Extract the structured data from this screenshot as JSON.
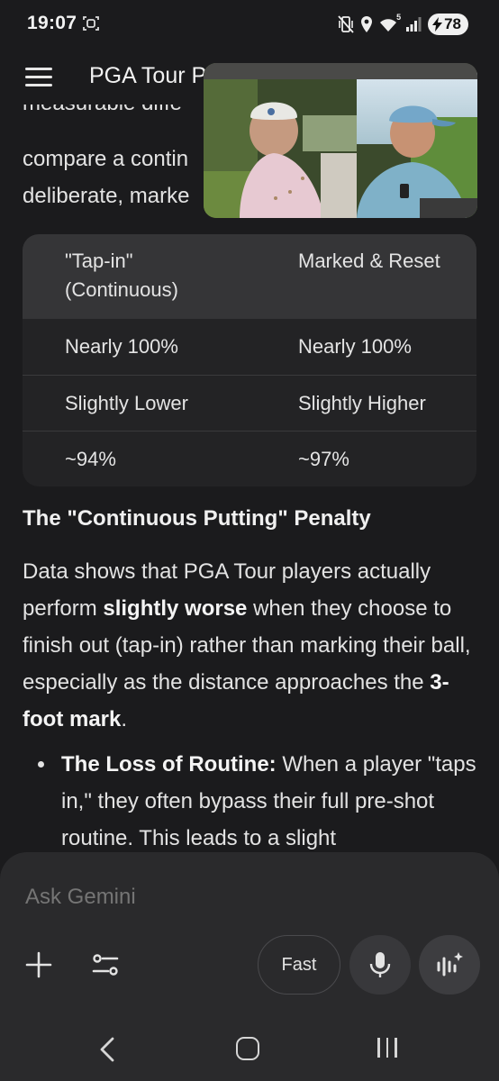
{
  "status_bar": {
    "time": "19:07",
    "wifi_badge": "5",
    "battery": "78",
    "icons": [
      "screen-record-icon",
      "vibrate-mute-icon",
      "location-icon",
      "wifi-icon",
      "signal-icon",
      "battery-charging-icon"
    ]
  },
  "app_bar": {
    "menu_icon": "hamburger-menu-icon",
    "title": "PGA Tour P"
  },
  "content": {
    "partial_lines": [
      "measurable diffe",
      "compare a contin",
      "deliberate, marke"
    ],
    "table": {
      "headers": [
        "\"Tap-in\" (Continuous)",
        "Marked & Reset"
      ],
      "rows": [
        [
          "Nearly 100%",
          "Nearly 100%"
        ],
        [
          "Slightly Lower",
          "Slightly Higher"
        ],
        [
          "~94%",
          "~97%"
        ]
      ]
    },
    "section_heading": "The \"Continuous Putting\" Penalty",
    "paragraph": {
      "t1": "Data shows that PGA Tour players actually perform ",
      "b1": "slightly worse",
      "t2": " when they choose to finish out (tap-in) rather than marking their ball, especially as the distance approaches the ",
      "b2": "3-foot mark",
      "t3": "."
    },
    "bullet": {
      "bold": "The Loss of Routine:",
      "text": " When a player \"taps in,\" they often bypass their full pre-shot routine. This leads to a slight"
    }
  },
  "input_panel": {
    "placeholder": "Ask Gemini",
    "fast_label": "Fast",
    "icons": [
      "plus-icon",
      "tools-sliders-icon",
      "microphone-icon",
      "live-waveform-icon"
    ]
  },
  "colors": {
    "background": "#1b1b1d",
    "table_header": "#353537",
    "table_body": "#232325",
    "panel": "#2a2a2c",
    "text": "#e3e3e3"
  }
}
